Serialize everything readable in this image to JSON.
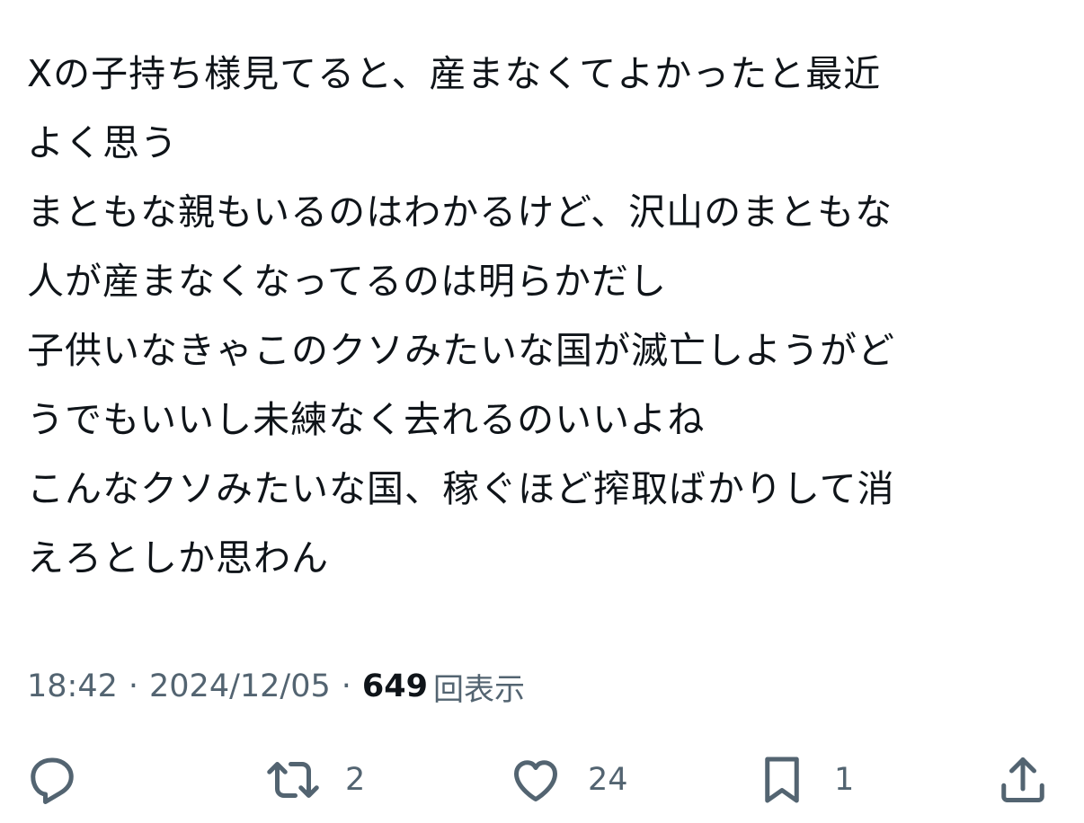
{
  "tweet": {
    "lines": [
      "Xの子持ち様見てると、産まなくてよかったと最近",
      "よく思う",
      "まともな親もいるのはわかるけど、沢山のまともな",
      "人が産まなくなってるのは明らかだし",
      "子供いなきゃこのクソみたいな国が滅亡しようがど",
      "うでもいいし未練なく去れるのいいよね",
      "こんなクソみたいな国、稼ぐほど搾取ばかりして消",
      "えろとしか思わん"
    ]
  },
  "meta": {
    "time": "18:42",
    "separator": "·",
    "date": "2024/12/05",
    "views_count": "649",
    "views_label": "回表示"
  },
  "actions": {
    "reply": {
      "icon": "reply-icon",
      "count": ""
    },
    "repost": {
      "icon": "repost-icon",
      "count": "2"
    },
    "like": {
      "icon": "heart-icon",
      "count": "24"
    },
    "bookmark": {
      "icon": "bookmark-icon",
      "count": "1"
    },
    "share": {
      "icon": "share-icon",
      "count": ""
    }
  },
  "colors": {
    "text_primary": "#0f1419",
    "text_secondary": "#536471",
    "background": "#ffffff"
  }
}
